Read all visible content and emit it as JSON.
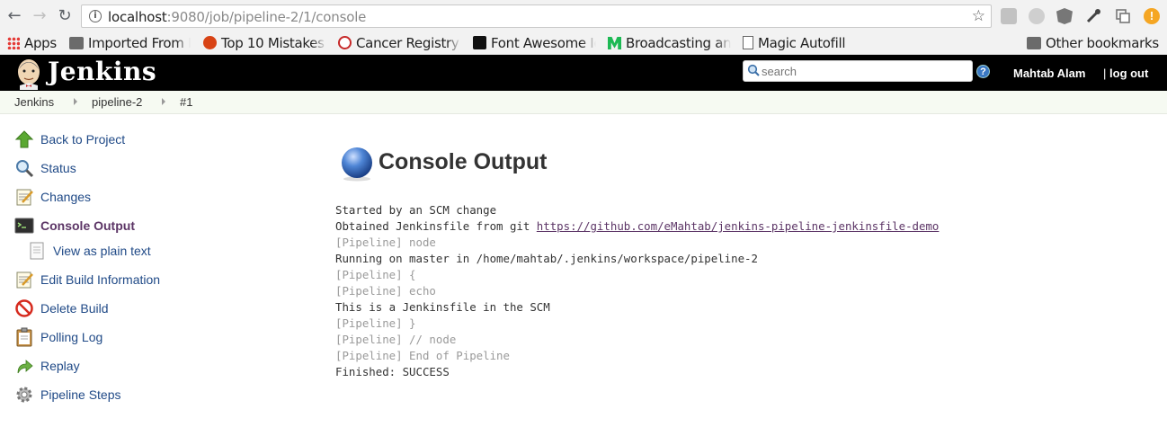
{
  "browser": {
    "url_host": "localhost",
    "url_rest": ":9080/job/pipeline-2/1/console",
    "bookmarks": [
      {
        "label": "Apps"
      },
      {
        "label": "Imported From F"
      },
      {
        "label": "Top 10 Mistakes i"
      },
      {
        "label": "Cancer Registry F"
      },
      {
        "label": "Font Awesome Ic"
      },
      {
        "label": "Broadcasting an"
      },
      {
        "label": "Magic Autofill"
      }
    ],
    "other_bookmarks": "Other bookmarks",
    "extension_colors": [
      "#bdbdbd",
      "#bdbdbd",
      "#7a7a7a",
      "#555555",
      "#888888",
      "#f9a825"
    ],
    "alert_icon_color": "#f5a623"
  },
  "header": {
    "app_title": "Jenkins",
    "search_placeholder": "search",
    "help": "?",
    "user": "Mahtab Alam",
    "logout_sep": "|",
    "logout": "log out"
  },
  "breadcrumbs": [
    "Jenkins",
    "pipeline-2",
    "#1"
  ],
  "sidebar": {
    "items": [
      {
        "label": "Back to Project",
        "icon": "up-arrow-icon"
      },
      {
        "label": "Status",
        "icon": "magnifier-icon"
      },
      {
        "label": "Changes",
        "icon": "notepad-icon"
      },
      {
        "label": "Console Output",
        "icon": "terminal-icon",
        "active": true
      },
      {
        "label": "View as plain text",
        "icon": "document-icon",
        "sub": true
      },
      {
        "label": "Edit Build Information",
        "icon": "notepad-icon"
      },
      {
        "label": "Delete Build",
        "icon": "no-entry-icon"
      },
      {
        "label": "Polling Log",
        "icon": "clipboard-icon"
      },
      {
        "label": "Replay",
        "icon": "redo-arrow-icon"
      },
      {
        "label": "Pipeline Steps",
        "icon": "gear-icon"
      }
    ]
  },
  "main": {
    "title": "Console Output",
    "status_ball_color": "#3a6fc4",
    "console": {
      "line1": "Started by an SCM change",
      "line2_prefix": "Obtained Jenkinsfile from git ",
      "line2_link": "https://github.com/eMahtab/jenkins-pipeline-jenkinsfile-demo",
      "line3": "[Pipeline] node",
      "line4": "Running on master in /home/mahtab/.jenkins/workspace/pipeline-2",
      "line5": "[Pipeline] {",
      "line6": "[Pipeline] echo",
      "line7": "This is a Jenkinsfile in the SCM",
      "line8": "[Pipeline] }",
      "line9": "[Pipeline] // node",
      "line10": "[Pipeline] End of Pipeline",
      "line11": "Finished: SUCCESS"
    }
  }
}
